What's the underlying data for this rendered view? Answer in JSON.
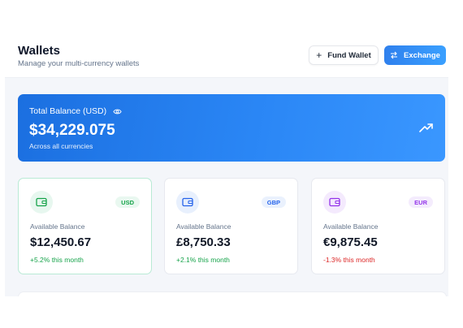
{
  "header": {
    "title": "Wallets",
    "subtitle": "Manage your multi-currency wallets",
    "fund_button": "Fund Wallet",
    "exchange_button": "Exchange"
  },
  "total": {
    "label": "Total Balance (USD)",
    "value": "$34,229.075",
    "caption": "Across all currencies"
  },
  "wallets": [
    {
      "currency": "USD",
      "label": "Available Balance",
      "amount": "$12,450.67",
      "change": "+5.2% this month",
      "accent": "#16a34a",
      "icon_bg": "#e7f7ef",
      "badge_bg": "#e9f8f0",
      "change_color": "#16a34a"
    },
    {
      "currency": "GBP",
      "label": "Available Balance",
      "amount": "£8,750.33",
      "change": "+2.1% this month",
      "accent": "#2563eb",
      "icon_bg": "#e8f0fd",
      "badge_bg": "#eaf1fd",
      "change_color": "#16a34a"
    },
    {
      "currency": "EUR",
      "label": "Available Balance",
      "amount": "€9,875.45",
      "change": "-1.3% this month",
      "accent": "#9333ea",
      "icon_bg": "#f4eafd",
      "badge_bg": "#f4ecfd",
      "change_color": "#dc2626"
    }
  ],
  "icons": {
    "fund": "plus-icon",
    "exchange": "exchange-icon",
    "visibility": "eye-icon",
    "trend": "trending-up-icon",
    "wallet": "wallet-icon"
  }
}
